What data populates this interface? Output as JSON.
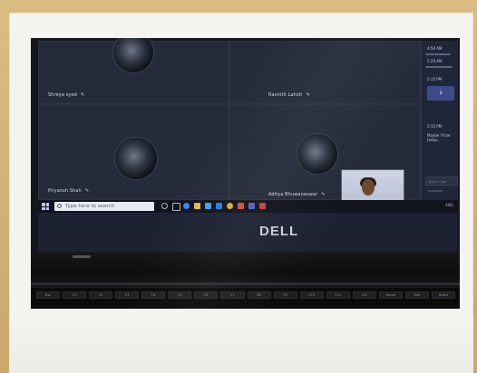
{
  "participants": [
    {
      "name": "Shreya syed"
    },
    {
      "name": "Ravnith Lahoti"
    },
    {
      "name": "Priyansh Shah"
    },
    {
      "name": "Aditya Bhuwaneswar"
    }
  ],
  "taskbar": {
    "search_placeholder": "Type here to search",
    "tray_text": "ENG"
  },
  "chat": {
    "times": [
      "4:58 AM",
      "5:24 AM",
      "2:15 PM",
      "2:15 PM"
    ],
    "last_message": "Maybe I'll be today...",
    "input_placeholder": "Type a new message"
  },
  "laptop": {
    "brand": "DELL"
  },
  "keys": [
    "Esc",
    "F1",
    "F2",
    "F3",
    "F4",
    "F5",
    "F6",
    "F7",
    "F8",
    "F9",
    "F10",
    "F11",
    "F12",
    "Home",
    "End",
    "Insert"
  ]
}
